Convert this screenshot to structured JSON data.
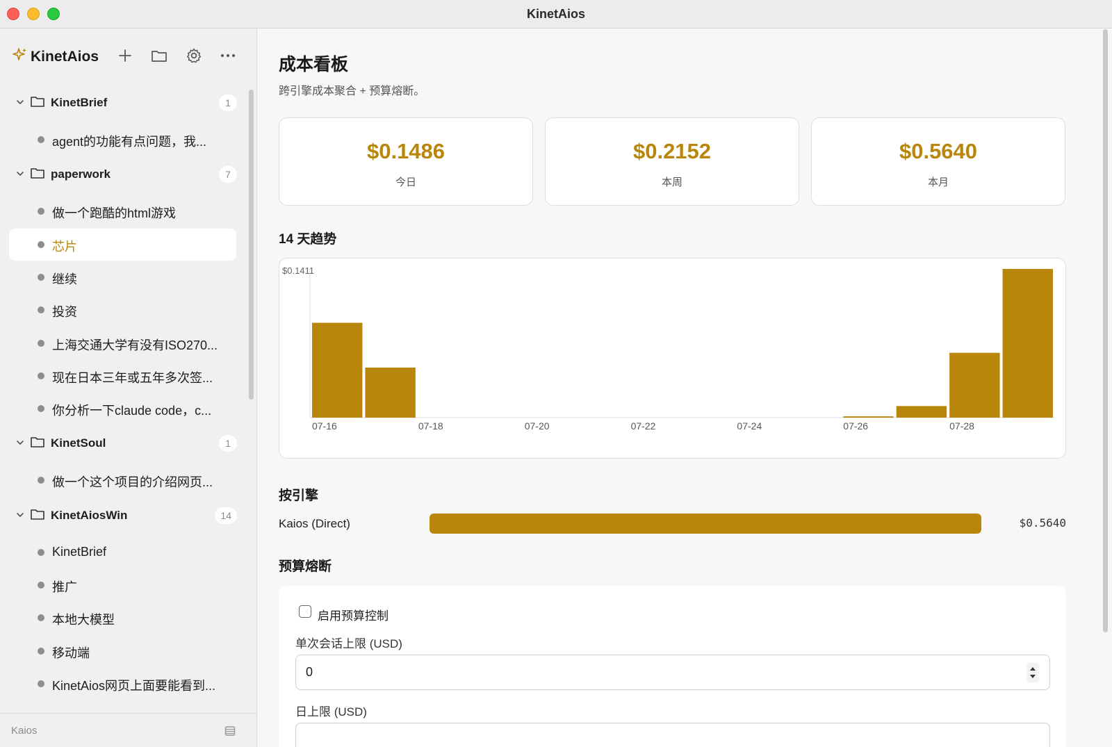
{
  "window": {
    "title": "KinetAios"
  },
  "sidebar": {
    "brand": "KinetAios",
    "folders": [
      {
        "name": "KinetBrief",
        "count": "1",
        "items": [
          "agent的功能有点问题，我..."
        ]
      },
      {
        "name": "paperwork",
        "count": "7",
        "items": [
          "做一个跑酷的html游戏",
          "芯片",
          "继续",
          "投资",
          "上海交通大学有没有ISO270...",
          "现在日本三年或五年多次签...",
          "你分析一下claude code，c..."
        ]
      },
      {
        "name": "KinetSoul",
        "count": "1",
        "items": [
          "做一个这个项目的介绍网页..."
        ]
      },
      {
        "name": "KinetAiosWin",
        "count": "14",
        "items": [
          "KinetBrief",
          "推广",
          "本地大模型",
          "移动端",
          "KinetAios网页上面要能看到..."
        ]
      }
    ],
    "active_item": "芯片",
    "footer": "Kaios"
  },
  "main": {
    "title": "成本看板",
    "subtitle": "跨引擎成本聚合 + 预算熔断。",
    "cards": [
      {
        "value": "$0.1486",
        "label": "今日"
      },
      {
        "value": "$0.2152",
        "label": "本周"
      },
      {
        "value": "$0.5640",
        "label": "本月"
      }
    ],
    "trend_title": "14 天趋势",
    "engine_title": "按引擎",
    "engines": [
      {
        "name": "Kaios (Direct)",
        "value": "$0.5640",
        "share": 1.0
      }
    ],
    "budget_title": "预算熔断",
    "budget": {
      "enable_label": "启用预算控制",
      "enabled": false,
      "session_limit_label": "单次会话上限 (USD)",
      "session_limit_value": "0",
      "daily_limit_label": "日上限 (USD)"
    }
  },
  "colors": {
    "accent": "#b8860b"
  },
  "chart_data": {
    "type": "bar",
    "title": "14 天趋势",
    "ymax_label": "$0.1411",
    "ylim": [
      0,
      0.1411
    ],
    "categories": [
      "07-16",
      "07-17",
      "07-18",
      "07-19",
      "07-20",
      "07-21",
      "07-22",
      "07-23",
      "07-24",
      "07-25",
      "07-26",
      "07-27",
      "07-28",
      "07-29"
    ],
    "tick_labels": [
      "07-16",
      "07-18",
      "07-20",
      "07-22",
      "07-24",
      "07-26",
      "07-28"
    ],
    "values": [
      0.09,
      0.0475,
      0,
      0,
      0,
      0,
      0,
      0,
      0,
      0,
      0.0012,
      0.011,
      0.0615,
      0.1411
    ]
  }
}
